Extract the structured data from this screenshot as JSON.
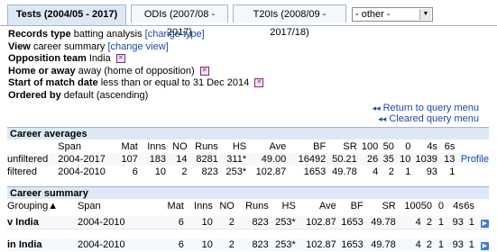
{
  "tabs": [
    {
      "label": "Tests (2004/05 - 2017)",
      "active": true
    },
    {
      "label": "ODIs (2007/08 - 2017)",
      "active": false
    },
    {
      "label": "T20Is (2008/09 - 2017/18)",
      "active": false
    }
  ],
  "other_select": {
    "value": "- other -"
  },
  "filters": {
    "records_type": {
      "label": "Records type",
      "value": "batting analysis",
      "link": "[change type]"
    },
    "view": {
      "label": "View",
      "value": "career summary",
      "link": "[change view]"
    },
    "opposition": {
      "label": "Opposition team",
      "value": "India"
    },
    "home_away": {
      "label": "Home or away",
      "value": "away (home of opposition)"
    },
    "start_date": {
      "label": "Start of match date",
      "value": "less than or equal to 31 Dec 2014"
    },
    "ordered_by": {
      "label": "Ordered by",
      "value": "default (ascending)"
    }
  },
  "links": {
    "return": "Return to query menu",
    "cleared": "Cleared query menu"
  },
  "career_averages": {
    "title": "Career averages",
    "headers": [
      "",
      "Span",
      "Mat",
      "Inns",
      "NO",
      "Runs",
      "HS",
      "Ave",
      "BF",
      "SR",
      "100",
      "50",
      "0",
      "4s",
      "6s",
      ""
    ],
    "rows": [
      [
        "unfiltered",
        "2004-2017",
        "107",
        "183",
        "14",
        "8281",
        "311*",
        "49.00",
        "16492",
        "50.21",
        "26",
        "35",
        "10",
        "1039",
        "13",
        "Profile"
      ],
      [
        "filtered",
        "2004-2010",
        "6",
        "10",
        "2",
        "823",
        "253*",
        "102.87",
        "1653",
        "49.78",
        "4",
        "2",
        "1",
        "93",
        "1",
        ""
      ]
    ]
  },
  "career_summary": {
    "title": "Career summary",
    "headers": [
      "Grouping▲",
      "Span",
      "Mat",
      "Inns",
      "NO",
      "Runs",
      "HS",
      "Ave",
      "BF",
      "SR",
      "100",
      "50",
      "0",
      "4s",
      "6s",
      ""
    ],
    "rows": [
      [
        "v India",
        "2004-2010",
        "6",
        "10",
        "2",
        "823",
        "253*",
        "102.87",
        "1653",
        "49.78",
        "4",
        "2",
        "1",
        "93",
        "1"
      ],
      [
        "in India",
        "2004-2010",
        "6",
        "10",
        "2",
        "823",
        "253*",
        "102.87",
        "1653",
        "49.78",
        "4",
        "2",
        "1",
        "93",
        "1"
      ]
    ]
  }
}
